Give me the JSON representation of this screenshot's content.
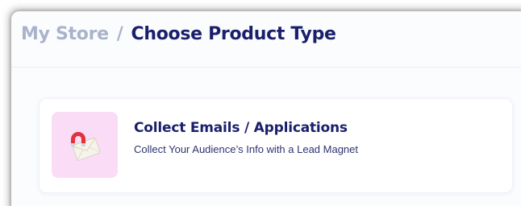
{
  "breadcrumb": {
    "parent": "My Store",
    "separator": "/",
    "current": "Choose Product Type"
  },
  "product_types": [
    {
      "title": "Collect Emails / Applications",
      "subtitle": "Collect Your Audience’s Info with a Lead Magnet",
      "icon": "magnet-envelope-icon",
      "tile_color": "#fadcf7"
    }
  ],
  "colors": {
    "heading": "#1a1f6b",
    "breadcrumb_muted": "#a9b3ca",
    "page_background": "#fbfcfe"
  }
}
